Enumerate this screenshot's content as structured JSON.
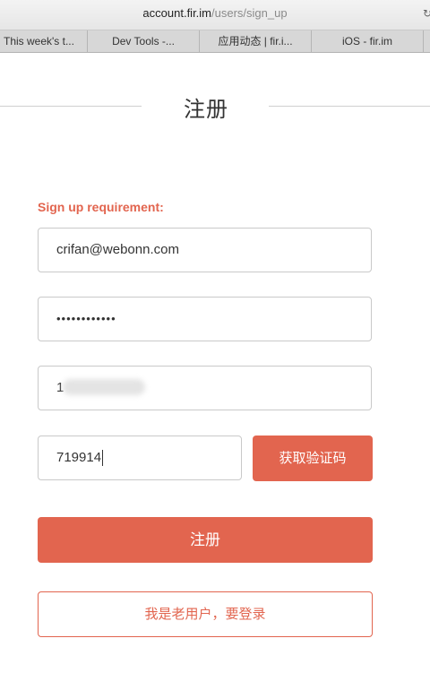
{
  "browser": {
    "url_host": "account.fir.im",
    "url_path": "/users/sign_up",
    "tabs": [
      {
        "label": "This week's t..."
      },
      {
        "label": "Dev Tools -..."
      },
      {
        "label": "应用动态 | fir.i..."
      },
      {
        "label": "iOS - fir.im"
      }
    ]
  },
  "page": {
    "title": "注册",
    "requirement": "Sign up requirement:"
  },
  "form": {
    "email_value": "crifan@webonn.com",
    "password_value": "••••••••••••",
    "phone_value": "1",
    "code_value": "719914",
    "get_code_label": "获取验证码",
    "submit_label": "注册",
    "login_label": "我是老用户，要登录"
  },
  "colors": {
    "accent": "#e2654f"
  }
}
